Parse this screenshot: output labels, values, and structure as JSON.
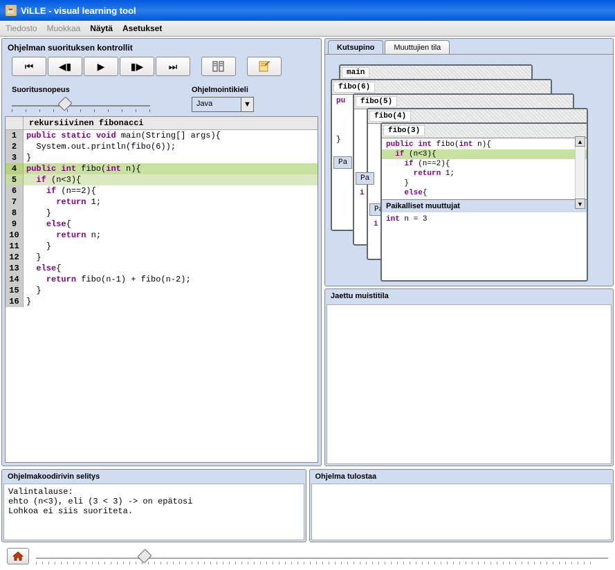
{
  "window": {
    "title": "ViLLE - visual learning tool"
  },
  "menu": {
    "file": "Tiedosto",
    "edit": "Muokkaa",
    "view": "Näytä",
    "settings": "Asetukset"
  },
  "controls": {
    "title": "Ohjelman suorituksen kontrollit",
    "speed_label": "Suoritusnopeus",
    "lang_label": "Ohjelmointikieli",
    "lang_value": "Java"
  },
  "code": {
    "title": "rekursiivinen fibonacci",
    "lines": [
      "public static void main(String[] args){",
      "  System.out.println(fibo(6));",
      "}",
      "public int fibo(int n){",
      "  if (n<3){",
      "    if (n==2){",
      "      return 1;",
      "    }",
      "    else{",
      "      return n;",
      "    }",
      "  }",
      "  else{",
      "    return fibo(n-1) + fibo(n-2);",
      "  }",
      "}"
    ]
  },
  "tabs": {
    "callstack": "Kutsupino",
    "vars": "Muuttujien tila"
  },
  "stack": {
    "frames": [
      "main",
      "fibo(6)",
      "fibo(5)",
      "fibo(4)",
      "fibo(3)"
    ],
    "top_code": [
      "public int fibo(int n){",
      "  if (n<3){",
      "    if (n==2){",
      "      return 1;",
      "    }",
      "    else{"
    ],
    "locals_title": "Paikalliset muuttujat",
    "locals_body": "int n = 3"
  },
  "shared": {
    "title": "Jaettu muistitila"
  },
  "explain": {
    "title": "Ohjelmakoodirivin selitys",
    "body": "Valintalause:\nehto (n<3), eli (3 < 3) -> on epätosi\nLohkoa ei siis suoriteta."
  },
  "output": {
    "title": "Ohjelma tulostaa"
  }
}
